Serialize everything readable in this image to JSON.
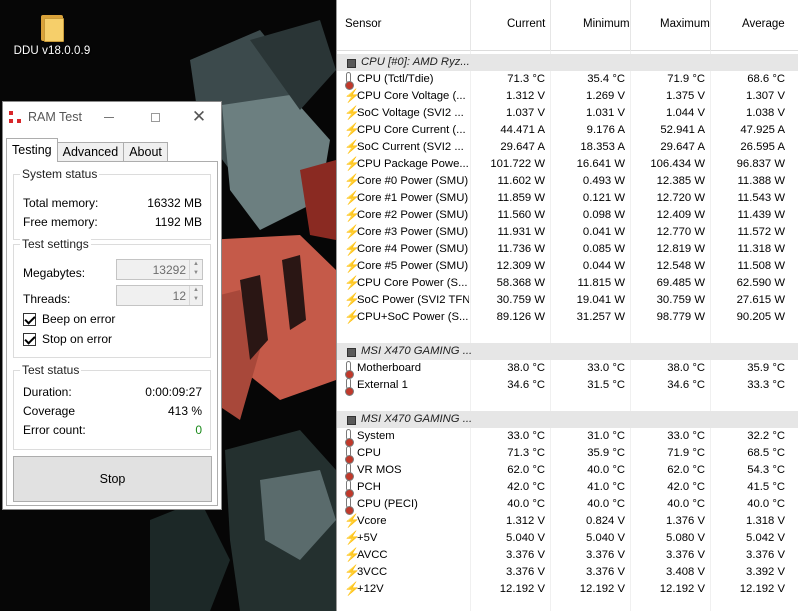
{
  "desktop": {
    "icon_label": "DDU v18.0.0.9"
  },
  "ram_test": {
    "title": "RAM Test",
    "tabs": [
      "Testing",
      "Advanced",
      "About"
    ],
    "system_status": {
      "title": "System status",
      "total_label": "Total memory:",
      "total_value": "16332 MB",
      "free_label": "Free memory:",
      "free_value": "1192 MB"
    },
    "test_settings": {
      "title": "Test settings",
      "megabytes_label": "Megabytes:",
      "megabytes_value": "13292",
      "threads_label": "Threads:",
      "threads_value": "12",
      "beep_label": "Beep on error",
      "beep_checked": true,
      "stop_label": "Stop on error",
      "stop_checked": true
    },
    "test_status": {
      "title": "Test status",
      "duration_label": "Duration:",
      "duration_value": "0:00:09:27",
      "coverage_label": "Coverage",
      "coverage_value": "413 %",
      "errors_label": "Error count:",
      "errors_value": "0",
      "errors_color": "#1a8a1a"
    },
    "stop_button": "Stop"
  },
  "hwinfo": {
    "columns": [
      "Sensor",
      "Current",
      "Minimum",
      "Maximum",
      "Average"
    ],
    "rows": [
      {
        "type": "group",
        "name": "CPU [#0]: AMD Ryz..."
      },
      {
        "type": "temp",
        "name": "CPU (Tctl/Tdie)",
        "cur": "71.3 °C",
        "min": "35.4 °C",
        "max": "71.9 °C",
        "avg": "68.6 °C"
      },
      {
        "type": "power",
        "name": "CPU Core Voltage (...",
        "cur": "1.312 V",
        "min": "1.269 V",
        "max": "1.375 V",
        "avg": "1.307 V"
      },
      {
        "type": "power",
        "name": "SoC Voltage (SVI2 ...",
        "cur": "1.037 V",
        "min": "1.031 V",
        "max": "1.044 V",
        "avg": "1.038 V"
      },
      {
        "type": "power",
        "name": "CPU Core Current (...",
        "cur": "44.471 A",
        "min": "9.176 A",
        "max": "52.941 A",
        "avg": "47.925 A"
      },
      {
        "type": "power",
        "name": "SoC Current (SVI2 ...",
        "cur": "29.647 A",
        "min": "18.353 A",
        "max": "29.647 A",
        "avg": "26.595 A"
      },
      {
        "type": "power",
        "name": "CPU Package Powe...",
        "cur": "101.722 W",
        "min": "16.641 W",
        "max": "106.434 W",
        "avg": "96.837 W"
      },
      {
        "type": "power",
        "name": "Core #0 Power (SMU)",
        "cur": "11.602 W",
        "min": "0.493 W",
        "max": "12.385 W",
        "avg": "11.388 W"
      },
      {
        "type": "power",
        "name": "Core #1 Power (SMU)",
        "cur": "11.859 W",
        "min": "0.121 W",
        "max": "12.720 W",
        "avg": "11.543 W"
      },
      {
        "type": "power",
        "name": "Core #2 Power (SMU)",
        "cur": "11.560 W",
        "min": "0.098 W",
        "max": "12.409 W",
        "avg": "11.439 W"
      },
      {
        "type": "power",
        "name": "Core #3 Power (SMU)",
        "cur": "11.931 W",
        "min": "0.041 W",
        "max": "12.770 W",
        "avg": "11.572 W"
      },
      {
        "type": "power",
        "name": "Core #4 Power (SMU)",
        "cur": "11.736 W",
        "min": "0.085 W",
        "max": "12.819 W",
        "avg": "11.318 W"
      },
      {
        "type": "power",
        "name": "Core #5 Power (SMU)",
        "cur": "12.309 W",
        "min": "0.044 W",
        "max": "12.548 W",
        "avg": "11.508 W"
      },
      {
        "type": "power",
        "name": "CPU Core Power (S...",
        "cur": "58.368 W",
        "min": "11.815 W",
        "max": "69.485 W",
        "avg": "62.590 W"
      },
      {
        "type": "power",
        "name": "SoC Power (SVI2 TFN)",
        "cur": "30.759 W",
        "min": "19.041 W",
        "max": "30.759 W",
        "avg": "27.615 W"
      },
      {
        "type": "power",
        "name": "CPU+SoC Power (S...",
        "cur": "89.126 W",
        "min": "31.257 W",
        "max": "98.779 W",
        "avg": "90.205 W"
      },
      {
        "type": "blank"
      },
      {
        "type": "group",
        "name": "MSI X470 GAMING ..."
      },
      {
        "type": "temp",
        "name": "Motherboard",
        "cur": "38.0 °C",
        "min": "33.0 °C",
        "max": "38.0 °C",
        "avg": "35.9 °C"
      },
      {
        "type": "temp",
        "name": "External 1",
        "cur": "34.6 °C",
        "min": "31.5 °C",
        "max": "34.6 °C",
        "avg": "33.3 °C"
      },
      {
        "type": "blank"
      },
      {
        "type": "group",
        "name": "MSI X470 GAMING ..."
      },
      {
        "type": "temp",
        "name": "System",
        "cur": "33.0 °C",
        "min": "31.0 °C",
        "max": "33.0 °C",
        "avg": "32.2 °C"
      },
      {
        "type": "temp",
        "name": "CPU",
        "cur": "71.3 °C",
        "min": "35.9 °C",
        "max": "71.9 °C",
        "avg": "68.5 °C"
      },
      {
        "type": "temp",
        "name": "VR MOS",
        "cur": "62.0 °C",
        "min": "40.0 °C",
        "max": "62.0 °C",
        "avg": "54.3 °C"
      },
      {
        "type": "temp",
        "name": "PCH",
        "cur": "42.0 °C",
        "min": "41.0 °C",
        "max": "42.0 °C",
        "avg": "41.5 °C"
      },
      {
        "type": "temp",
        "name": "CPU (PECI)",
        "cur": "40.0 °C",
        "min": "40.0 °C",
        "max": "40.0 °C",
        "avg": "40.0 °C"
      },
      {
        "type": "power",
        "name": "Vcore",
        "cur": "1.312 V",
        "min": "0.824 V",
        "max": "1.376 V",
        "avg": "1.318 V"
      },
      {
        "type": "power",
        "name": "+5V",
        "cur": "5.040 V",
        "min": "5.040 V",
        "max": "5.080 V",
        "avg": "5.042 V"
      },
      {
        "type": "power",
        "name": "AVCC",
        "cur": "3.376 V",
        "min": "3.376 V",
        "max": "3.376 V",
        "avg": "3.376 V"
      },
      {
        "type": "power",
        "name": "3VCC",
        "cur": "3.376 V",
        "min": "3.376 V",
        "max": "3.408 V",
        "avg": "3.392 V"
      },
      {
        "type": "power",
        "name": "+12V",
        "cur": "12.192 V",
        "min": "12.192 V",
        "max": "12.192 V",
        "avg": "12.192 V"
      }
    ]
  }
}
